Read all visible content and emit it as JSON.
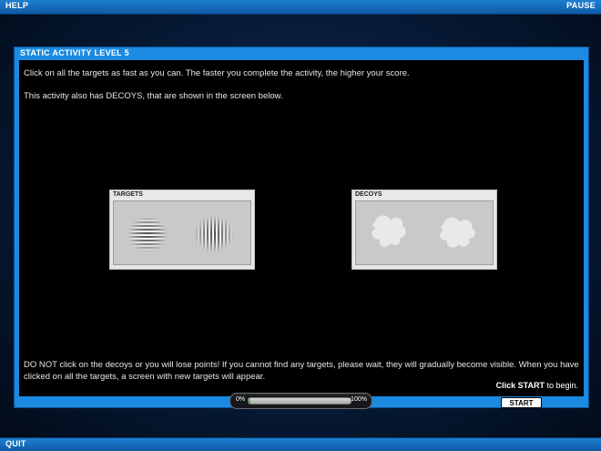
{
  "header": {
    "help": "HELP",
    "pause": "PAUSE"
  },
  "footer": {
    "quit": "QUIT"
  },
  "panel": {
    "title": "STATIC ACTIVITY LEVEL 5",
    "instruction_1": "Click on all the targets as fast as you can. The faster you complete the activity, the higher your score.",
    "instruction_2": "This activity also has DECOYS, that are shown in the screen below.",
    "instruction_3": "DO NOT click on the decoys or you will lose points! If you cannot find any targets, please wait, they will gradually become visible. When you have clicked on all the targets, a screen with new targets will appear.",
    "click_start_bold": "Click START",
    "click_start_rest": " to begin."
  },
  "targets_card": {
    "label": "TARGETS"
  },
  "decoys_card": {
    "label": "DECOYS"
  },
  "start_button": {
    "label": "START"
  },
  "progress": {
    "min_label": "0%",
    "max_label": "100%",
    "value": 0.02
  },
  "colors": {
    "panel_blue": "#1b8ae0",
    "progress_green": "#3fb834"
  }
}
